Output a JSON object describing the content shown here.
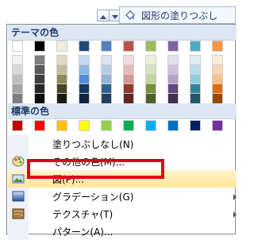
{
  "toolbar": {
    "button_label": "図形の塗りつぶし"
  },
  "palette": {
    "theme_header": "テーマの色",
    "standard_header": "標準の色",
    "theme_rows": [
      [
        "#ffffff",
        "#000000",
        "#eeece1",
        "#1f497d",
        "#4f81bd",
        "#c0504d",
        "#9bbb59",
        "#8064a2",
        "#4bacc6",
        "#f79646"
      ],
      [
        "#f2f2f2",
        "#7f7f7f",
        "#ddd9c3",
        "#c6d9f0",
        "#dbe5f1",
        "#f2dcdb",
        "#ebf1dd",
        "#e5e0ec",
        "#dbeef3",
        "#fdeada"
      ],
      [
        "#d8d8d8",
        "#595959",
        "#c4bd97",
        "#8db3e2",
        "#b8cce4",
        "#e5b9b7",
        "#d7e3bc",
        "#ccc1d9",
        "#b7dde8",
        "#fbd5b5"
      ],
      [
        "#bfbfbf",
        "#3f3f3f",
        "#938953",
        "#548dd4",
        "#95b3d7",
        "#d99694",
        "#c3d69b",
        "#b2a2c7",
        "#92cddc",
        "#fac08f"
      ],
      [
        "#a5a5a5",
        "#262626",
        "#494429",
        "#17365d",
        "#366092",
        "#953734",
        "#76923c",
        "#5f497a",
        "#31859b",
        "#e36c09"
      ],
      [
        "#7f7f7f",
        "#0c0c0c",
        "#1d1b10",
        "#0f243e",
        "#244061",
        "#632423",
        "#4f6128",
        "#3f3151",
        "#205867",
        "#974806"
      ]
    ],
    "standard_row": [
      "#c00000",
      "#ff0000",
      "#ffc000",
      "#ffff00",
      "#92d050",
      "#00b050",
      "#00b0f0",
      "#0070c0",
      "#002060",
      "#7030a0"
    ]
  },
  "menu_items": [
    {
      "label": "塗りつぶしなし(N)"
    },
    {
      "label": "その他の色(M)..."
    },
    {
      "label": "図(P)..."
    },
    {
      "label": "グラデーション(G)"
    },
    {
      "label": "テクスチャ(T)"
    },
    {
      "label": "パターン(A)..."
    }
  ],
  "colors": {
    "highlight": "#ffe69a",
    "annotation": "#e1001a"
  }
}
